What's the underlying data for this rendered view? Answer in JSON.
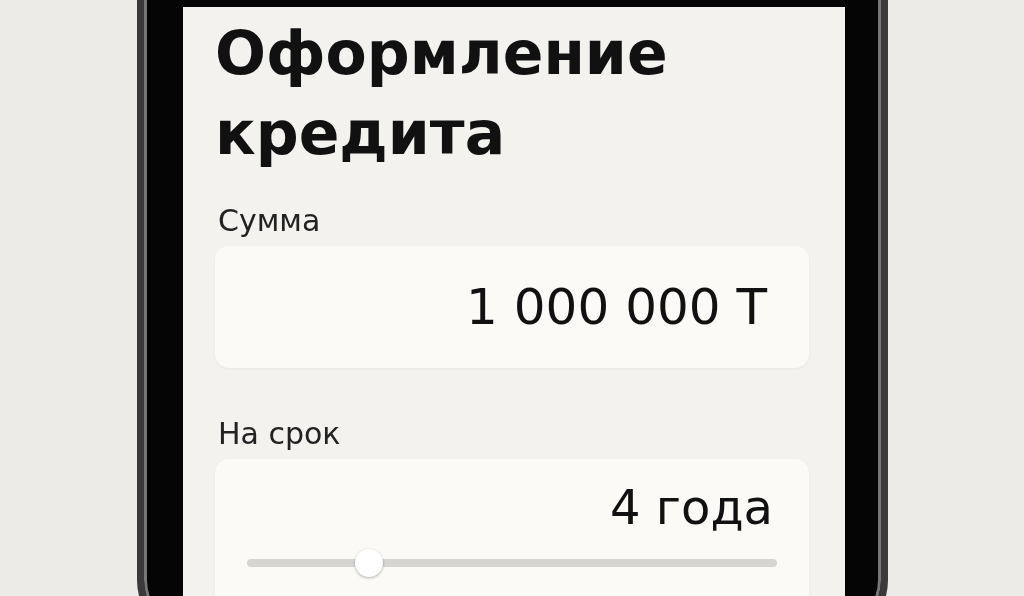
{
  "title": "Оформление кредита",
  "fields": [
    {
      "kind": "amount",
      "label": "Сумма",
      "value": "1 000 000 Т"
    },
    {
      "kind": "slider",
      "label": "На срок",
      "value": "4 года",
      "level": 0.23
    }
  ]
}
